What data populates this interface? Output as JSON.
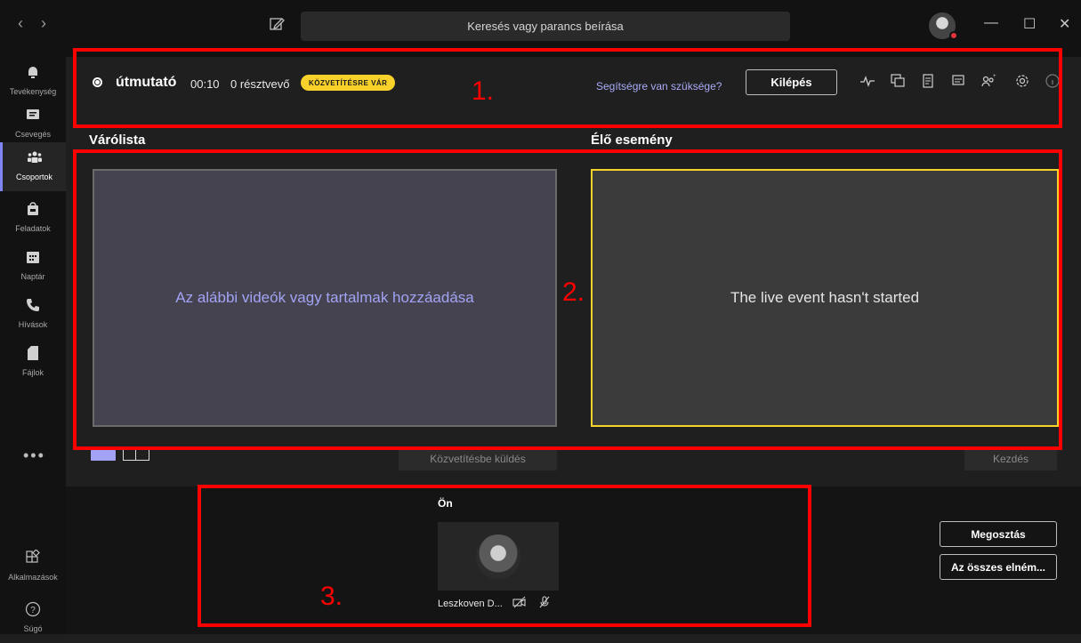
{
  "titlebar": {
    "back": "‹",
    "forward": "›",
    "search_placeholder": "Keresés vagy parancs beírása",
    "minimize": "—",
    "maximize": "☐",
    "close": "✕"
  },
  "rail": {
    "items": [
      {
        "label": "Tevékenység",
        "icon": "bell-icon"
      },
      {
        "label": "Csevegés",
        "icon": "chat-icon"
      },
      {
        "label": "Csoportok",
        "icon": "teams-icon",
        "active": true
      },
      {
        "label": "Feladatok",
        "icon": "assignments-icon"
      },
      {
        "label": "Naptár",
        "icon": "calendar-icon"
      },
      {
        "label": "Hívások",
        "icon": "phone-icon"
      },
      {
        "label": "Fájlok",
        "icon": "file-icon"
      }
    ],
    "more": "•••",
    "apps_label": "Alkalmazások",
    "help_label": "Súgó"
  },
  "header": {
    "title": "útmutató",
    "time": "00:10",
    "participants": "0 résztvevő",
    "status_badge": "KÖZVETÍTÉSRE VÁR",
    "help_link": "Segítségre van szüksége?",
    "exit_label": "Kilépés",
    "tools": [
      "health-icon",
      "qna-icon",
      "notes-icon",
      "chat-icon",
      "people-icon",
      "settings-icon",
      "info-icon"
    ]
  },
  "queue": {
    "heading": "Várólista",
    "placeholder": "Az alábbi videók vagy tartalmak hozzáadása",
    "send_label": "Közvetítésbe küldés"
  },
  "live": {
    "heading": "Élő esemény",
    "status": "The live event hasn't started",
    "start_label": "Kezdés"
  },
  "self": {
    "label": "Ön",
    "name": "Leszkoven D..."
  },
  "actions": {
    "share": "Megosztás",
    "all_items": "Az összes elném..."
  },
  "annotations": [
    "1.",
    "2.",
    "3."
  ],
  "colors": {
    "accent": "#7f85f5",
    "badge": "#f8d22a",
    "annotation": "#ff0000"
  }
}
